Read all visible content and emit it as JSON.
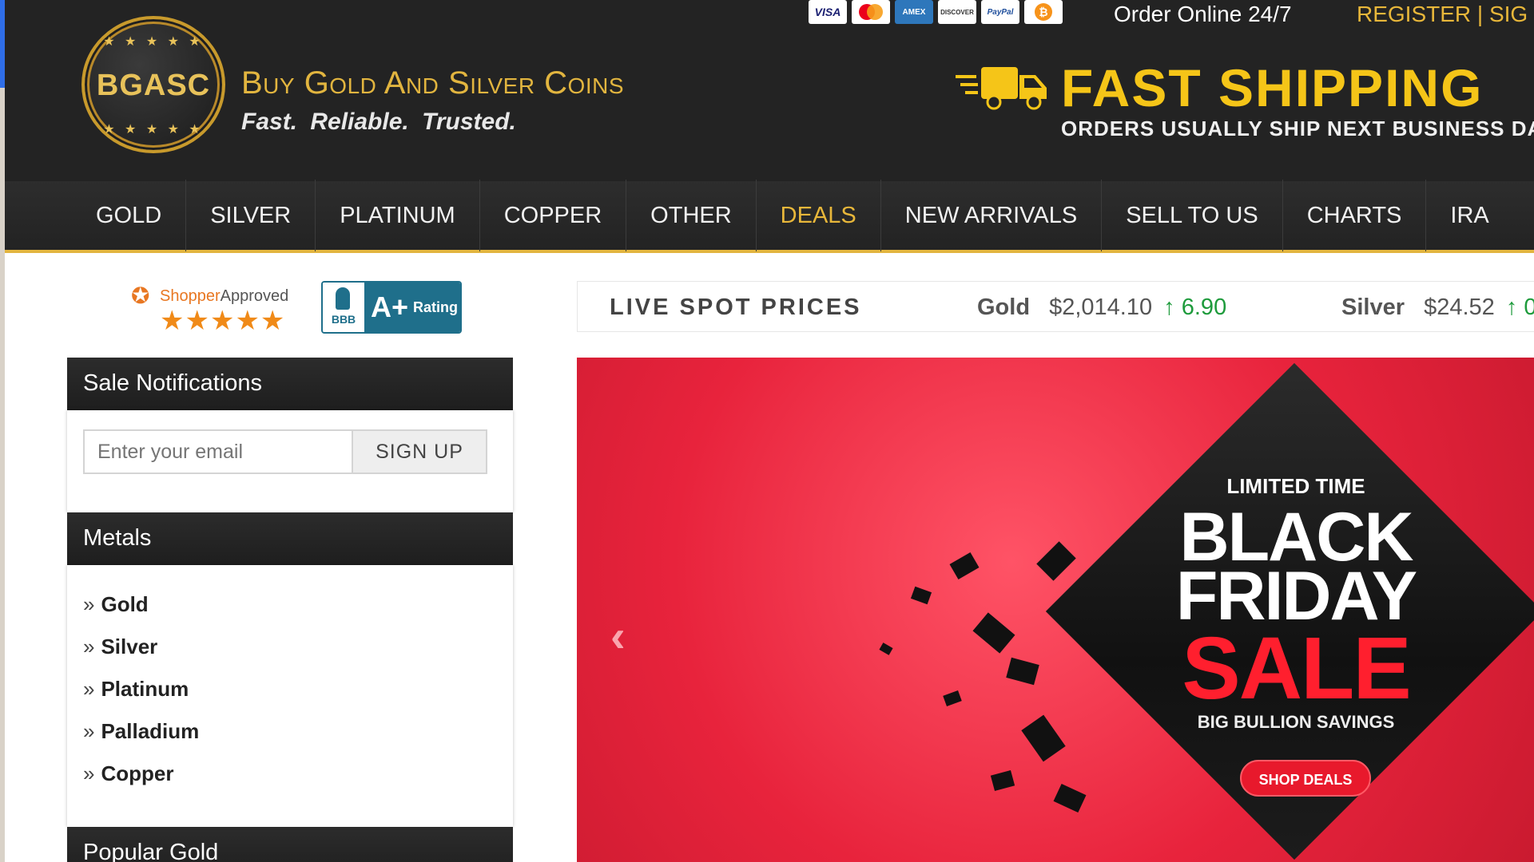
{
  "header": {
    "logo_abbr": "BGASC",
    "logo_stars": "★ ★ ★ ★ ★",
    "brand_name": "Buy Gold And Silver Coins",
    "tagline": "Fast. Reliable. Trusted.",
    "payment_methods": [
      "VISA",
      "Mastercard",
      "AMEX",
      "DISCOVER",
      "PayPal",
      "Bitcoin"
    ],
    "payment_labels": {
      "visa": "VISA",
      "amex": "AMEX",
      "discover": "DISCOVER",
      "paypal": "PayPal",
      "bitcoin": "₿"
    },
    "order_online": "Order Online 24/7",
    "register_signin": "REGISTER | SIG",
    "shipping_title": "FAST SHIPPING",
    "shipping_sub": "ORDERS USUALLY SHIP NEXT BUSINESS DAY"
  },
  "nav": {
    "items": [
      "GOLD",
      "SILVER",
      "PLATINUM",
      "COPPER",
      "OTHER",
      "DEALS",
      "NEW ARRIVALS",
      "SELL TO US",
      "CHARTS",
      "IRA"
    ],
    "highlight": "DEALS",
    "accent_color": "#e8b73a"
  },
  "badges": {
    "shopper_approved_brand": "Shopper",
    "shopper_approved_word": "Approved",
    "shopper_stars": "★★★★★",
    "bbb_label": "BBB",
    "bbb_grade": "A+",
    "bbb_rating_word": "Rating"
  },
  "spot": {
    "title": "LIVE SPOT PRICES",
    "metals": [
      {
        "name": "Gold",
        "price": "$2,014.10",
        "change": "6.90"
      },
      {
        "name": "Silver",
        "price": "$24.52",
        "change": "0"
      }
    ],
    "up_arrow": "↑",
    "up_color": "#1e9b3c"
  },
  "sidebar": {
    "sale_notifications": {
      "title": "Sale Notifications",
      "email_placeholder": "Enter your email",
      "signup_label": "SIGN UP"
    },
    "metals": {
      "title": "Metals",
      "links": [
        "Gold",
        "Silver",
        "Platinum",
        "Palladium",
        "Copper"
      ],
      "bullet": "»"
    },
    "popular_gold": {
      "title": "Popular Gold"
    }
  },
  "hero": {
    "prev_arrow": "‹",
    "limited_time": "LIMITED TIME",
    "line1": "BLACK",
    "line2": "FRIDAY",
    "line3": "SALE",
    "subline": "BIG BULLION SAVINGS",
    "cta": "SHOP DEALS",
    "bg_color": "#e8233c"
  }
}
